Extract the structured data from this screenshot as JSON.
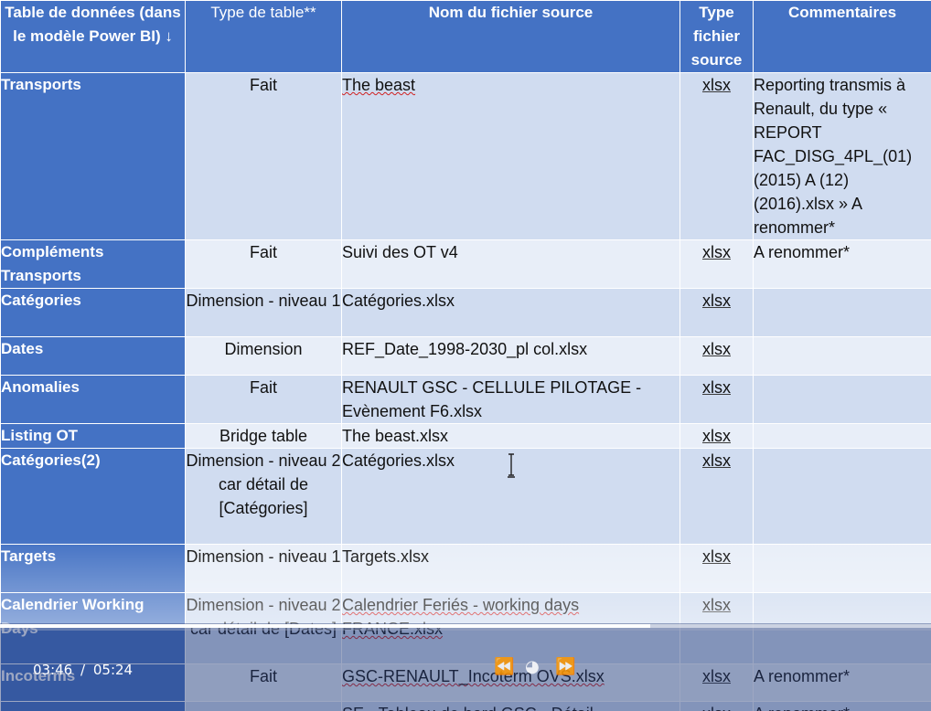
{
  "headers": {
    "table": "Table de données (dans le modèle Power BI) ↓",
    "type": "Type de table**",
    "source": "Nom du fichier source",
    "filetype": "Type fichier source",
    "comments": "Commentaires"
  },
  "rows": [
    {
      "name": "Transports",
      "type": "Fait",
      "source": "The beast",
      "filetype": "xlsx",
      "comment": "Reporting transmis à Renault, du type « REPORT FAC_DISG_4PL_(01) (2015) A (12) (2016).xlsx » A renommer*"
    },
    {
      "name": "Compléments Transports",
      "type": "Fait",
      "source": "Suivi des OT v4",
      "filetype": "xlsx",
      "comment": "A renommer*"
    },
    {
      "name": "Catégories",
      "type": "Dimension - niveau 1",
      "source": "Catégories.xlsx",
      "filetype": "xlsx",
      "comment": ""
    },
    {
      "name": "Dates",
      "type": "Dimension",
      "source": "REF_Date_1998-2030_pl col.xlsx",
      "filetype": "xlsx",
      "comment": ""
    },
    {
      "name": "Anomalies",
      "type": "Fait",
      "source": "RENAULT GSC - CELLULE PILOTAGE - Evènement F6.xlsx",
      "filetype": "xlsx",
      "comment": ""
    },
    {
      "name": "Listing OT",
      "type": "Bridge table",
      "source": "The beast.xlsx",
      "filetype": "xlsx",
      "comment": ""
    },
    {
      "name": "Catégories(2)",
      "type": "Dimension - niveau 2 car détail de [Catégories]",
      "source": "Catégories.xlsx",
      "filetype": "xlsx",
      "comment": ""
    },
    {
      "name": "Targets",
      "type": "Dimension - niveau 1",
      "source": "Targets.xlsx",
      "filetype": "xlsx",
      "comment": ""
    },
    {
      "name": "Calendrier Working Days",
      "type": "Dimension - niveau 2 car détail de [Dates]",
      "source": "Calendrier Feriés - working days FRANCE.xlsx",
      "filetype": "xlsx",
      "comment": ""
    },
    {
      "name": "Incoterms",
      "type": "Fait",
      "source": "GSC-RENAULT_Incoterm OVS.xlsx",
      "filetype": "xlsx",
      "comment": "A renommer*"
    },
    {
      "name": "",
      "type": "",
      "source": "SE - Tableau de bord GSC - Détail",
      "filetype": "xlsx",
      "comment": "A renommer*"
    }
  ],
  "player": {
    "current_time": "03:46",
    "separator": "/",
    "duration": "05:24",
    "progress_fraction": 0.698
  },
  "colors": {
    "header_blue": "#4472c4",
    "row_light": "#e8eef8",
    "row_dark": "#d0dcf0"
  }
}
